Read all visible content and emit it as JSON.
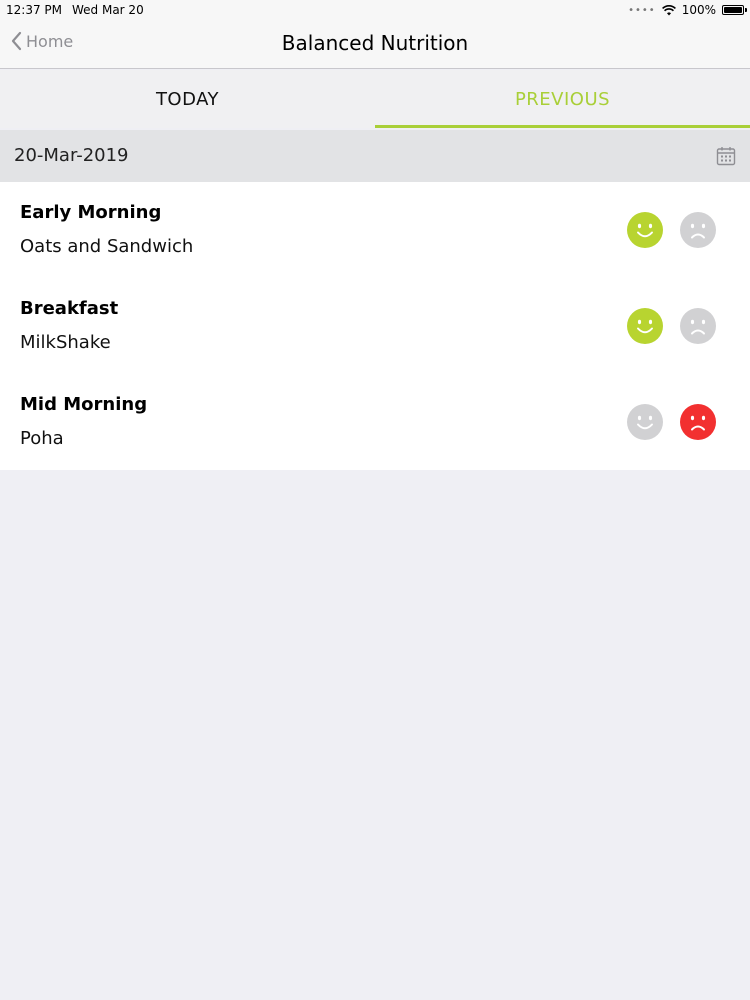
{
  "status_bar": {
    "time": "12:37 PM",
    "date": "Wed Mar 20",
    "battery": "100%",
    "battery_level": 1.0
  },
  "nav": {
    "back_label": "Home",
    "title": "Balanced Nutrition"
  },
  "tabs": [
    {
      "label": "TODAY",
      "active": false
    },
    {
      "label": "PREVIOUS",
      "active": true
    }
  ],
  "date_header": {
    "date": "20-Mar-2019",
    "icon": "calendar-icon"
  },
  "colors": {
    "accent": "#a9cf38",
    "happy_selected": "#b8d430",
    "sad_selected": "#f23030",
    "unselected": "#d1d1d3"
  },
  "meals": [
    {
      "title": "Early Morning",
      "item": "Oats and Sandwich",
      "rating": "happy"
    },
    {
      "title": "Breakfast",
      "item": "MilkShake",
      "rating": "happy"
    },
    {
      "title": "Mid Morning",
      "item": "Poha",
      "rating": "sad"
    }
  ]
}
